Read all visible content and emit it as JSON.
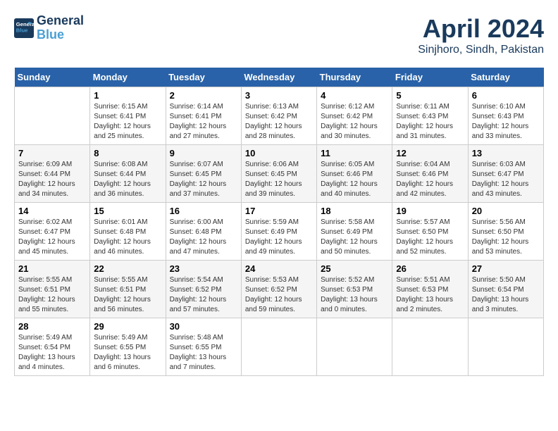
{
  "header": {
    "logo_line1": "General",
    "logo_line2": "Blue",
    "title": "April 2024",
    "subtitle": "Sinjhoro, Sindh, Pakistan"
  },
  "days_of_week": [
    "Sunday",
    "Monday",
    "Tuesday",
    "Wednesday",
    "Thursday",
    "Friday",
    "Saturday"
  ],
  "weeks": [
    [
      {
        "num": "",
        "detail": ""
      },
      {
        "num": "1",
        "detail": "Sunrise: 6:15 AM\nSunset: 6:41 PM\nDaylight: 12 hours\nand 25 minutes."
      },
      {
        "num": "2",
        "detail": "Sunrise: 6:14 AM\nSunset: 6:41 PM\nDaylight: 12 hours\nand 27 minutes."
      },
      {
        "num": "3",
        "detail": "Sunrise: 6:13 AM\nSunset: 6:42 PM\nDaylight: 12 hours\nand 28 minutes."
      },
      {
        "num": "4",
        "detail": "Sunrise: 6:12 AM\nSunset: 6:42 PM\nDaylight: 12 hours\nand 30 minutes."
      },
      {
        "num": "5",
        "detail": "Sunrise: 6:11 AM\nSunset: 6:43 PM\nDaylight: 12 hours\nand 31 minutes."
      },
      {
        "num": "6",
        "detail": "Sunrise: 6:10 AM\nSunset: 6:43 PM\nDaylight: 12 hours\nand 33 minutes."
      }
    ],
    [
      {
        "num": "7",
        "detail": "Sunrise: 6:09 AM\nSunset: 6:44 PM\nDaylight: 12 hours\nand 34 minutes."
      },
      {
        "num": "8",
        "detail": "Sunrise: 6:08 AM\nSunset: 6:44 PM\nDaylight: 12 hours\nand 36 minutes."
      },
      {
        "num": "9",
        "detail": "Sunrise: 6:07 AM\nSunset: 6:45 PM\nDaylight: 12 hours\nand 37 minutes."
      },
      {
        "num": "10",
        "detail": "Sunrise: 6:06 AM\nSunset: 6:45 PM\nDaylight: 12 hours\nand 39 minutes."
      },
      {
        "num": "11",
        "detail": "Sunrise: 6:05 AM\nSunset: 6:46 PM\nDaylight: 12 hours\nand 40 minutes."
      },
      {
        "num": "12",
        "detail": "Sunrise: 6:04 AM\nSunset: 6:46 PM\nDaylight: 12 hours\nand 42 minutes."
      },
      {
        "num": "13",
        "detail": "Sunrise: 6:03 AM\nSunset: 6:47 PM\nDaylight: 12 hours\nand 43 minutes."
      }
    ],
    [
      {
        "num": "14",
        "detail": "Sunrise: 6:02 AM\nSunset: 6:47 PM\nDaylight: 12 hours\nand 45 minutes."
      },
      {
        "num": "15",
        "detail": "Sunrise: 6:01 AM\nSunset: 6:48 PM\nDaylight: 12 hours\nand 46 minutes."
      },
      {
        "num": "16",
        "detail": "Sunrise: 6:00 AM\nSunset: 6:48 PM\nDaylight: 12 hours\nand 47 minutes."
      },
      {
        "num": "17",
        "detail": "Sunrise: 5:59 AM\nSunset: 6:49 PM\nDaylight: 12 hours\nand 49 minutes."
      },
      {
        "num": "18",
        "detail": "Sunrise: 5:58 AM\nSunset: 6:49 PM\nDaylight: 12 hours\nand 50 minutes."
      },
      {
        "num": "19",
        "detail": "Sunrise: 5:57 AM\nSunset: 6:50 PM\nDaylight: 12 hours\nand 52 minutes."
      },
      {
        "num": "20",
        "detail": "Sunrise: 5:56 AM\nSunset: 6:50 PM\nDaylight: 12 hours\nand 53 minutes."
      }
    ],
    [
      {
        "num": "21",
        "detail": "Sunrise: 5:55 AM\nSunset: 6:51 PM\nDaylight: 12 hours\nand 55 minutes."
      },
      {
        "num": "22",
        "detail": "Sunrise: 5:55 AM\nSunset: 6:51 PM\nDaylight: 12 hours\nand 56 minutes."
      },
      {
        "num": "23",
        "detail": "Sunrise: 5:54 AM\nSunset: 6:52 PM\nDaylight: 12 hours\nand 57 minutes."
      },
      {
        "num": "24",
        "detail": "Sunrise: 5:53 AM\nSunset: 6:52 PM\nDaylight: 12 hours\nand 59 minutes."
      },
      {
        "num": "25",
        "detail": "Sunrise: 5:52 AM\nSunset: 6:53 PM\nDaylight: 13 hours\nand 0 minutes."
      },
      {
        "num": "26",
        "detail": "Sunrise: 5:51 AM\nSunset: 6:53 PM\nDaylight: 13 hours\nand 2 minutes."
      },
      {
        "num": "27",
        "detail": "Sunrise: 5:50 AM\nSunset: 6:54 PM\nDaylight: 13 hours\nand 3 minutes."
      }
    ],
    [
      {
        "num": "28",
        "detail": "Sunrise: 5:49 AM\nSunset: 6:54 PM\nDaylight: 13 hours\nand 4 minutes."
      },
      {
        "num": "29",
        "detail": "Sunrise: 5:49 AM\nSunset: 6:55 PM\nDaylight: 13 hours\nand 6 minutes."
      },
      {
        "num": "30",
        "detail": "Sunrise: 5:48 AM\nSunset: 6:55 PM\nDaylight: 13 hours\nand 7 minutes."
      },
      {
        "num": "",
        "detail": ""
      },
      {
        "num": "",
        "detail": ""
      },
      {
        "num": "",
        "detail": ""
      },
      {
        "num": "",
        "detail": ""
      }
    ]
  ]
}
